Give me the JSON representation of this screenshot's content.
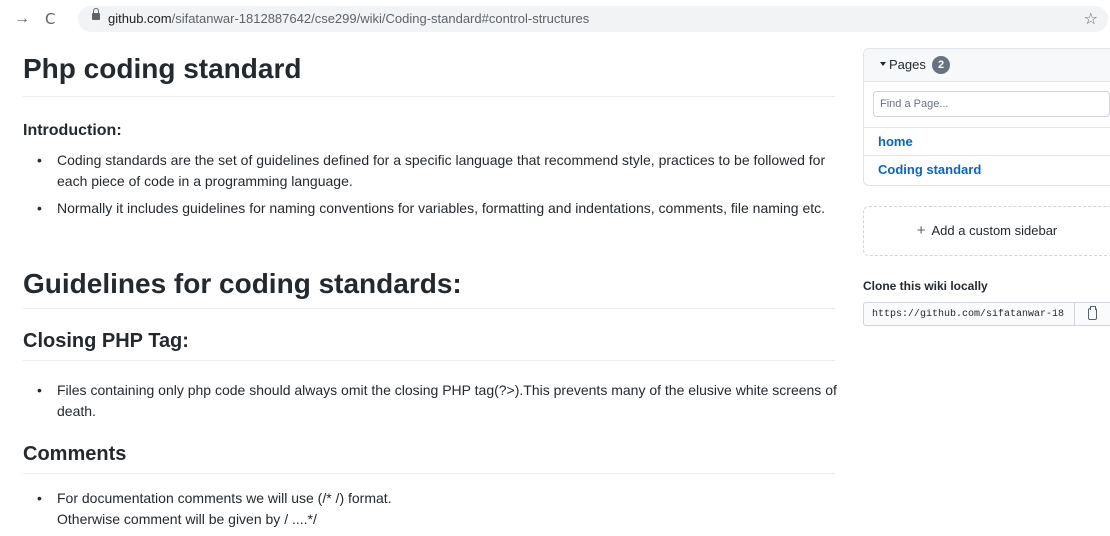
{
  "browser": {
    "back_icon": "→",
    "reload_icon": "C",
    "url_host": "github.com",
    "url_path": "/sifatanwar-1812887642/cse299/wiki/Coding-standard#control-structures",
    "star_icon": "☆"
  },
  "content": {
    "title": "Php coding standard",
    "intro_heading": "Introduction:",
    "intro_items": [
      "Coding standards are the set of guidelines defined for a specific language that recommend style, practices to be followed for each piece of code in a programming language.",
      "Normally it includes guidelines for naming conventions for variables, formatting and indentations, comments, file naming etc."
    ],
    "guidelines_heading": "Guidelines for coding standards:",
    "closing_tag_heading": "Closing PHP Tag:",
    "closing_tag_items": [
      "Files containing only php code should always omit the closing PHP tag(?>).This prevents many of the elusive white screens of death."
    ],
    "comments_heading": "Comments",
    "comments_line1": "For documentation comments we will use (/* /) format.",
    "comments_line2": "Otherwise comment will be given by / ....*/"
  },
  "sidebar": {
    "pages_label": "Pages",
    "pages_count": "2",
    "find_placeholder": "Find a Page...",
    "page_links": [
      "home",
      "Coding standard"
    ],
    "custom_sidebar_label": "Add a custom sidebar",
    "clone_title": "Clone this wiki locally",
    "clone_url": "https://github.com/sifatanwar-18:"
  }
}
